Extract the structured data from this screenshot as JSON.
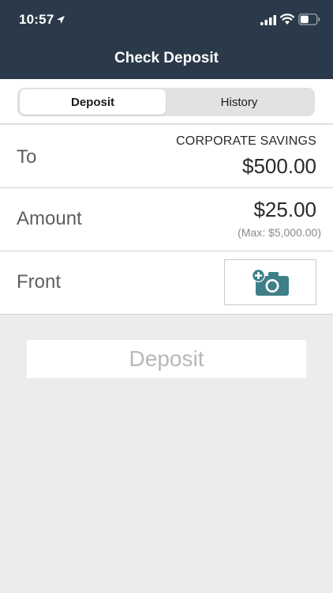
{
  "status_bar": {
    "time": "10:57",
    "icons": [
      "location-arrow-icon",
      "signal-icon",
      "wifi-icon",
      "battery-icon"
    ]
  },
  "nav": {
    "title": "Check Deposit"
  },
  "tabs": [
    {
      "label": "Deposit",
      "selected": true
    },
    {
      "label": "History",
      "selected": false
    }
  ],
  "form": {
    "to": {
      "label": "To",
      "account": "CORPORATE SAVINGS",
      "balance": "$500.00"
    },
    "amount": {
      "label": "Amount",
      "value": "$25.00",
      "max": "(Max: $5,000.00)"
    },
    "front": {
      "label": "Front",
      "icon": "add-camera-icon"
    }
  },
  "deposit_button": {
    "label": "Deposit"
  },
  "colors": {
    "header_bg": "#2b3a4a",
    "background": "#edebeb",
    "camera_icon": "#3f8088",
    "disabled_text": "#b8b8b8"
  }
}
